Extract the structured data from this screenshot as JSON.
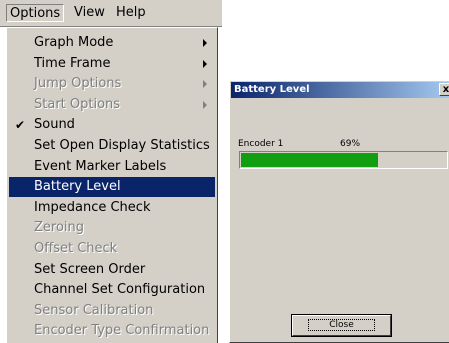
{
  "menubar": {
    "items": [
      "Options",
      "View",
      "Help"
    ]
  },
  "menu": {
    "items": [
      {
        "label": "Graph Mode",
        "submenu": true,
        "disabled": false,
        "checked": false,
        "highlighted": false
      },
      {
        "label": "Time Frame",
        "submenu": true,
        "disabled": false,
        "checked": false,
        "highlighted": false
      },
      {
        "label": "Jump Options",
        "submenu": true,
        "disabled": true,
        "checked": false,
        "highlighted": false
      },
      {
        "label": "Start Options",
        "submenu": true,
        "disabled": true,
        "checked": false,
        "highlighted": false
      },
      {
        "label": "Sound",
        "submenu": false,
        "disabled": false,
        "checked": true,
        "highlighted": false
      },
      {
        "label": "Set Open Display Statistics",
        "submenu": false,
        "disabled": false,
        "checked": false,
        "highlighted": false
      },
      {
        "label": "Event Marker Labels",
        "submenu": false,
        "disabled": false,
        "checked": false,
        "highlighted": false
      },
      {
        "label": "Battery Level",
        "submenu": false,
        "disabled": false,
        "checked": false,
        "highlighted": true
      },
      {
        "label": "Impedance Check",
        "submenu": false,
        "disabled": false,
        "checked": false,
        "highlighted": false
      },
      {
        "label": "Zeroing",
        "submenu": false,
        "disabled": true,
        "checked": false,
        "highlighted": false
      },
      {
        "label": "Offset Check",
        "submenu": false,
        "disabled": true,
        "checked": false,
        "highlighted": false
      },
      {
        "label": "Set Screen Order",
        "submenu": false,
        "disabled": false,
        "checked": false,
        "highlighted": false
      },
      {
        "label": "Channel Set Configuration",
        "submenu": false,
        "disabled": false,
        "checked": false,
        "highlighted": false
      },
      {
        "label": "Sensor Calibration",
        "submenu": false,
        "disabled": true,
        "checked": false,
        "highlighted": false
      },
      {
        "label": "Encoder Type Confirmation",
        "submenu": false,
        "disabled": true,
        "checked": false,
        "highlighted": false
      }
    ]
  },
  "dialog": {
    "title": "Battery Level",
    "close_glyph": "x",
    "encoder_label": "Encoder 1",
    "percent_text": "69%",
    "level": 0.69,
    "close_button": "Close",
    "fill_color": "#119e11"
  },
  "colors": {
    "highlight": "#0a246a",
    "face": "#d4d0c8"
  }
}
